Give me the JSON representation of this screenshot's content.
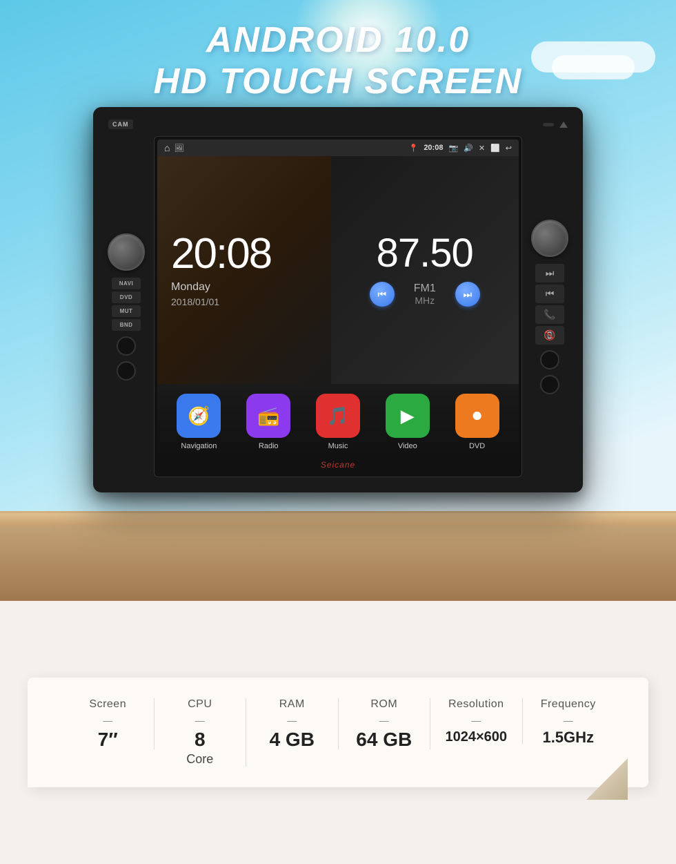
{
  "hero": {
    "title_line1": "ANDROID 10.0",
    "title_line2": "HD TOUCH SCREEN"
  },
  "stereo": {
    "topbar": {
      "cam_label": "CAM"
    },
    "left_buttons": [
      "NAVI",
      "DVD",
      "MUT",
      "BND"
    ],
    "status_bar": {
      "time": "20:08"
    },
    "clock": {
      "time": "20:08",
      "day": "Monday",
      "date": "2018/01/01"
    },
    "radio": {
      "frequency": "87.50",
      "band": "FM1",
      "unit": "MHz"
    },
    "apps": [
      {
        "label": "Navigation",
        "icon": "nav"
      },
      {
        "label": "Radio",
        "icon": "radio"
      },
      {
        "label": "Music",
        "icon": "music"
      },
      {
        "label": "Video",
        "icon": "video"
      },
      {
        "label": "DVD",
        "icon": "dvd"
      }
    ],
    "watermark": "Seicane"
  },
  "specs": [
    {
      "label": "Screen",
      "value": "7″",
      "sub": ""
    },
    {
      "label": "CPU",
      "value": "8",
      "sub": "Core"
    },
    {
      "label": "RAM",
      "value": "4 GB",
      "sub": ""
    },
    {
      "label": "ROM",
      "value": "64 GB",
      "sub": ""
    },
    {
      "label": "Resolution",
      "value": "1024×600",
      "sub": ""
    },
    {
      "label": "Frequency",
      "value": "1.5GHz",
      "sub": ""
    }
  ]
}
